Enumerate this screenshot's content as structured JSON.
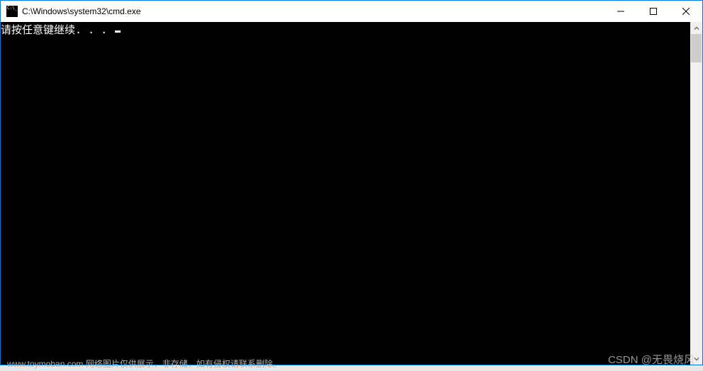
{
  "window": {
    "title": "C:\\Windows\\system32\\cmd.exe"
  },
  "console": {
    "line1": "请按任意键继续. . . "
  },
  "footer": {
    "text": "www.toymoban.com 网络图片仅供展示，非存储，如有侵权请联系删除。"
  },
  "watermark": {
    "text": "CSDN @无畏烧风"
  }
}
